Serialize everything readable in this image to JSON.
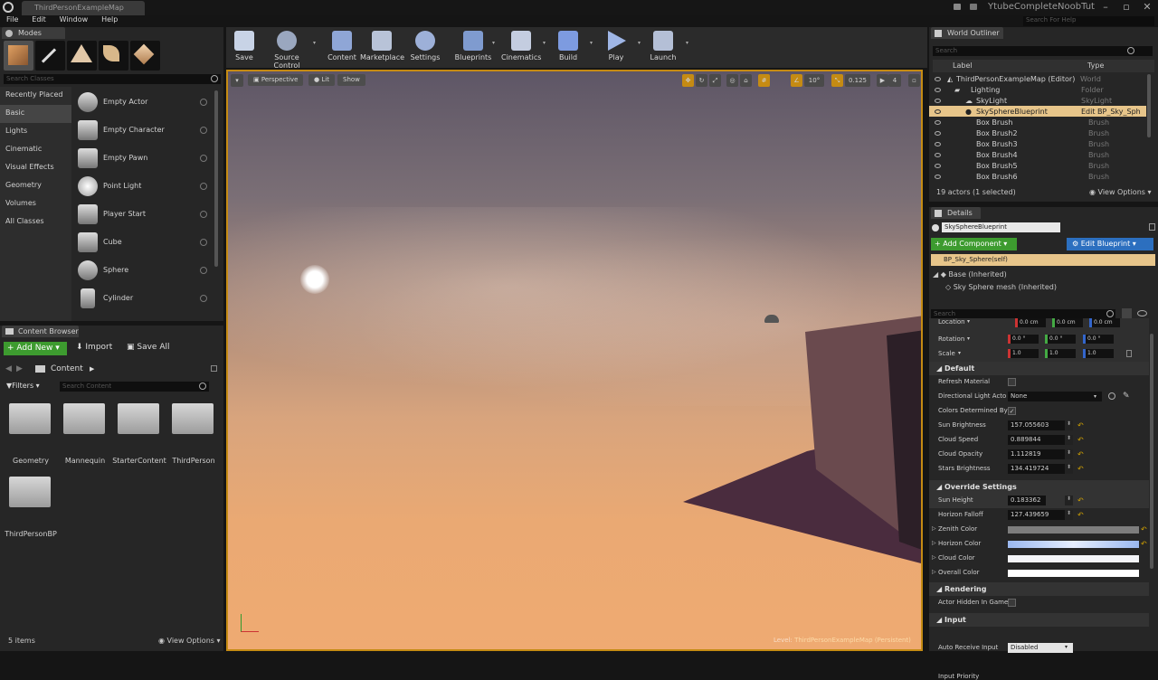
{
  "window": {
    "tab_title": "ThirdPersonExampleMap",
    "project_name": "YtubeCompleteNoobTut",
    "help_placeholder": "Search For Help"
  },
  "menu": [
    "File",
    "Edit",
    "Window",
    "Help"
  ],
  "modes": {
    "tab": "Modes",
    "search_placeholder": "Search Classes",
    "categories": [
      "Recently Placed",
      "Basic",
      "Lights",
      "Cinematic",
      "Visual Effects",
      "Geometry",
      "Volumes",
      "All Classes"
    ],
    "selected_category": "Basic",
    "items": [
      "Empty Actor",
      "Empty Character",
      "Empty Pawn",
      "Point Light",
      "Player Start",
      "Cube",
      "Sphere",
      "Cylinder"
    ]
  },
  "content_browser": {
    "tab": "Content Browser",
    "add_new": "Add New",
    "import": "Import",
    "save_all": "Save All",
    "path": "Content",
    "filters": "Filters",
    "search_placeholder": "Search Content",
    "folders": [
      "Geometry",
      "Mannequin",
      "StarterContent",
      "ThirdPerson",
      "ThirdPersonBP"
    ],
    "status": "5 items",
    "view_options": "View Options"
  },
  "toolbar": [
    "Save",
    "Source Control",
    "Content",
    "Marketplace",
    "Settings",
    "Blueprints",
    "Cinematics",
    "Build",
    "Play",
    "Launch"
  ],
  "viewport": {
    "perspective": "Perspective",
    "lit": "Lit",
    "show": "Show",
    "rotation_snap": "10°",
    "scale_snap": "0.125",
    "camera_speed": "4",
    "level_label": "Level:",
    "level_name": "ThirdPersonExampleMap (Persistent)"
  },
  "outliner": {
    "tab": "World Outliner",
    "search_placeholder": "Search",
    "col_label": "Label",
    "col_type": "Type",
    "rows": [
      {
        "label": "ThirdPersonExampleMap (Editor)",
        "type": "World"
      },
      {
        "label": "Lighting",
        "type": "Folder"
      },
      {
        "label": "SkyLight",
        "type": "SkyLight"
      },
      {
        "label": "SkySphereBlueprint",
        "type": "Edit BP_Sky_Sph"
      },
      {
        "label": "Box Brush",
        "type": "Brush"
      },
      {
        "label": "Box Brush2",
        "type": "Brush"
      },
      {
        "label": "Box Brush3",
        "type": "Brush"
      },
      {
        "label": "Box Brush4",
        "type": "Brush"
      },
      {
        "label": "Box Brush5",
        "type": "Brush"
      },
      {
        "label": "Box Brush6",
        "type": "Brush"
      }
    ],
    "selected_row": 3,
    "status": "19 actors (1 selected)",
    "view_options": "View Options"
  },
  "details": {
    "tab": "Details",
    "name": "SkySphereBlueprint",
    "add_component": "Add Component",
    "edit_blueprint": "Edit Blueprint",
    "self_component": "BP_Sky_Sphere(self)",
    "base": "Base (Inherited)",
    "mesh": "Sky Sphere mesh (Inherited)",
    "search_placeholder": "Search",
    "transform": [
      {
        "label": "Location",
        "x": "0.0 cm",
        "y": "0.0 cm",
        "z": "0.0 cm"
      },
      {
        "label": "Rotation",
        "x": "0.0 °",
        "y": "0.0 °",
        "z": "0.0 °"
      },
      {
        "label": "Scale",
        "x": "1.0",
        "y": "1.0",
        "z": "1.0"
      }
    ],
    "default_section": "Default",
    "refresh_material": "Refresh Material",
    "directional_light": "Directional Light Acto",
    "directional_value": "None",
    "colors_determined": "Colors Determined By",
    "numeric_props": [
      {
        "label": "Sun Brightness",
        "value": "157.055603"
      },
      {
        "label": "Cloud Speed",
        "value": "0.889844"
      },
      {
        "label": "Cloud Opacity",
        "value": "1.112819"
      },
      {
        "label": "Stars Brightness",
        "value": "134.419724"
      }
    ],
    "override_section": "Override Settings",
    "override_props": [
      {
        "label": "Sun Height",
        "value": "0.183362"
      },
      {
        "label": "Horizon Falloff",
        "value": "127.439659"
      }
    ],
    "color_props": [
      "Zenith Color",
      "Horizon Color",
      "Cloud Color",
      "Overall Color"
    ],
    "rendering_section": "Rendering",
    "actor_hidden": "Actor Hidden In Game",
    "input_section": "Input",
    "auto_receive_input": "Auto Receive Input",
    "auto_receive_value": "Disabled",
    "input_priority": "Input Priority"
  },
  "colors": {
    "accent": "#c58b13",
    "green": "#3d9b2f",
    "blue": "#2c6fbf",
    "selected_row": "#e7c58a"
  }
}
